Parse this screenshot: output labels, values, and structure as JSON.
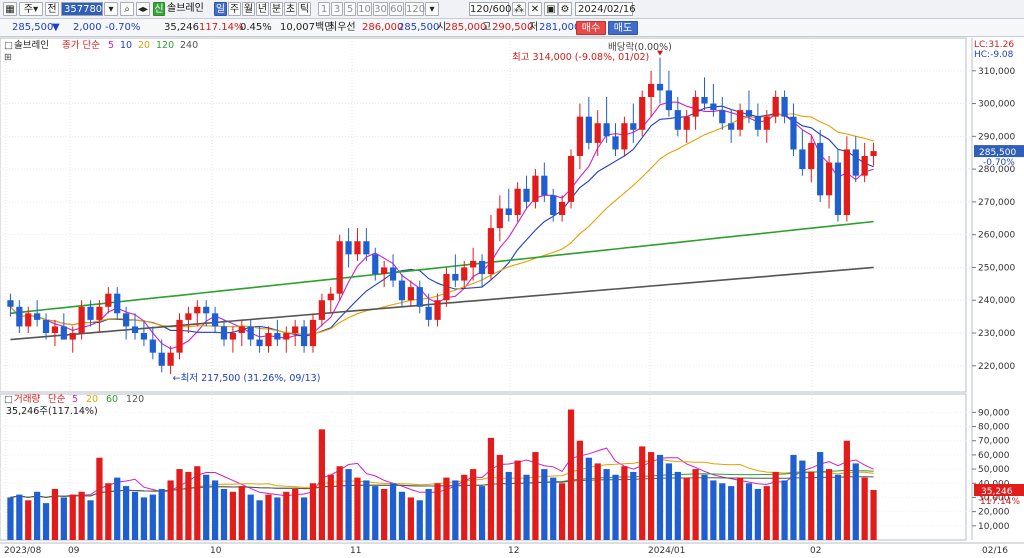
{
  "toolbar": {
    "code": "357780",
    "stock_name": "솔브레인",
    "period_buttons": [
      "일",
      "주",
      "월",
      "년",
      "분",
      "초",
      "틱"
    ],
    "minute_buttons": [
      "1",
      "3",
      "5",
      "10",
      "30",
      "60",
      "120"
    ],
    "count": "120/600",
    "date": "2024/02/16",
    "buy_label": "매수",
    "sell_label": "매도",
    "cal_label": "전",
    "small_icons": [
      "window-icon",
      "dropdown-icon",
      "refresh-icon",
      "chart-type-icon",
      "lock-icon",
      "gear-icon"
    ]
  },
  "quote": {
    "price": "285,500",
    "direction": "▼",
    "change": "2,000",
    "change_pct": "-0.70%",
    "volume": "35,246",
    "volume_ratio": "117.14%",
    "turnover_pct": "0.45%",
    "amount": "10,007백만",
    "bid_label": "최우선",
    "bid": "286,000",
    "ask": "285,500",
    "open_label": "시",
    "open": "285,000",
    "high_label": "고",
    "high": "290,500",
    "low_label": "저",
    "low": "281,000"
  },
  "price_panel": {
    "legend_name": "솔브레인",
    "legend_ma": "종가 단순",
    "ma_periods": [
      {
        "label": "5",
        "color": "#d020c8"
      },
      {
        "label": "10",
        "color": "#1f3fc7"
      },
      {
        "label": "20",
        "color": "#e8a000"
      },
      {
        "label": "120",
        "color": "#2ea02e"
      },
      {
        "label": "240",
        "color": "#555555"
      }
    ],
    "max_note": "최고 314,000 (-9.08%, 01/02)",
    "dividend_note": "배당락(0.00%)",
    "min_note": "←최저 217,500 (31.26%, 09/13)",
    "lc": "LC:31.26",
    "hc": "HC:-9.08",
    "price_box": "285,500",
    "price_box_pct": "-0.70%",
    "y_ticks": [
      "310,000",
      "300,000",
      "290,000",
      "280,000",
      "270,000",
      "260,000",
      "250,000",
      "240,000",
      "230,000",
      "220,000"
    ]
  },
  "volume_panel": {
    "legend_name": "거래량",
    "legend_ma": "단순",
    "ma_periods": [
      {
        "label": "5",
        "color": "#d020c8"
      },
      {
        "label": "20",
        "color": "#e8a000"
      },
      {
        "label": "60",
        "color": "#2ea02e"
      },
      {
        "label": "120",
        "color": "#555555"
      }
    ],
    "value_note": "35,246주(117.14%)",
    "vol_box": "35,246",
    "vol_box_pct": "117.14%",
    "y_ticks": [
      "90,000",
      "80,000",
      "70,000",
      "60,000",
      "50,000",
      "40,000",
      "30,000",
      "20,000",
      "10,000"
    ]
  },
  "x_labels": [
    "2023/08",
    "09",
    "10",
    "11",
    "12",
    "2024/01",
    "02",
    "02/16"
  ],
  "colors": {
    "up": "#e21b1b",
    "down": "#1f5fd0",
    "accent": "#3f6dc8"
  },
  "chart_data": {
    "type": "candlestick",
    "title": "솔브레인",
    "x_axis": [
      "2023/08",
      "09",
      "10",
      "11",
      "12",
      "2024/01",
      "02"
    ],
    "y_range": [
      212000,
      320000
    ],
    "volume_range": [
      0,
      98000
    ],
    "candles": [
      [
        240000,
        242000,
        235000,
        238000,
        30000
      ],
      [
        238000,
        240000,
        230000,
        232000,
        32000
      ],
      [
        232000,
        238000,
        230000,
        236000,
        28000
      ],
      [
        236000,
        240000,
        232000,
        234000,
        34000
      ],
      [
        234000,
        236000,
        228000,
        230000,
        26000
      ],
      [
        230000,
        234000,
        226000,
        232000,
        36000
      ],
      [
        232000,
        236000,
        228000,
        228000,
        30000
      ],
      [
        228000,
        232000,
        224000,
        230000,
        32000
      ],
      [
        230000,
        240000,
        228000,
        238000,
        34000
      ],
      [
        238000,
        240000,
        232000,
        234000,
        28000
      ],
      [
        234000,
        240000,
        230000,
        238000,
        58000
      ],
      [
        238000,
        244000,
        236000,
        242000,
        40000
      ],
      [
        242000,
        244000,
        234000,
        236000,
        44000
      ],
      [
        236000,
        238000,
        228000,
        232000,
        38000
      ],
      [
        232000,
        236000,
        228000,
        230000,
        34000
      ],
      [
        230000,
        234000,
        226000,
        228000,
        30000
      ],
      [
        228000,
        232000,
        222000,
        224000,
        32000
      ],
      [
        224000,
        228000,
        218000,
        220000,
        36000
      ],
      [
        220000,
        226000,
        217500,
        224000,
        42000
      ],
      [
        224000,
        236000,
        222000,
        234000,
        50000
      ],
      [
        234000,
        238000,
        230000,
        236000,
        48000
      ],
      [
        236000,
        240000,
        232000,
        238000,
        52000
      ],
      [
        238000,
        240000,
        232000,
        236000,
        46000
      ],
      [
        236000,
        238000,
        230000,
        232000,
        42000
      ],
      [
        232000,
        234000,
        226000,
        228000,
        36000
      ],
      [
        228000,
        232000,
        224000,
        230000,
        34000
      ],
      [
        230000,
        234000,
        226000,
        232000,
        38000
      ],
      [
        232000,
        234000,
        226000,
        228000,
        32000
      ],
      [
        228000,
        232000,
        224000,
        226000,
        28000
      ],
      [
        226000,
        232000,
        224000,
        230000,
        32000
      ],
      [
        230000,
        234000,
        226000,
        228000,
        30000
      ],
      [
        228000,
        232000,
        224000,
        230000,
        34000
      ],
      [
        230000,
        234000,
        226000,
        232000,
        36000
      ],
      [
        232000,
        234000,
        224000,
        226000,
        30000
      ],
      [
        226000,
        236000,
        224000,
        234000,
        40000
      ],
      [
        234000,
        242000,
        232000,
        240000,
        78000
      ],
      [
        240000,
        244000,
        236000,
        242000,
        46000
      ],
      [
        242000,
        260000,
        240000,
        258000,
        52000
      ],
      [
        258000,
        262000,
        250000,
        254000,
        50000
      ],
      [
        254000,
        262000,
        252000,
        258000,
        44000
      ],
      [
        258000,
        262000,
        252000,
        254000,
        42000
      ],
      [
        254000,
        256000,
        246000,
        248000,
        38000
      ],
      [
        248000,
        252000,
        244000,
        250000,
        36000
      ],
      [
        250000,
        254000,
        244000,
        246000,
        40000
      ],
      [
        246000,
        248000,
        238000,
        240000,
        34000
      ],
      [
        240000,
        246000,
        238000,
        244000,
        30000
      ],
      [
        244000,
        246000,
        236000,
        238000,
        28000
      ],
      [
        238000,
        242000,
        232000,
        234000,
        36000
      ],
      [
        234000,
        242000,
        232000,
        240000,
        40000
      ],
      [
        240000,
        250000,
        238000,
        248000,
        44000
      ],
      [
        248000,
        254000,
        244000,
        246000,
        42000
      ],
      [
        246000,
        252000,
        244000,
        250000,
        46000
      ],
      [
        250000,
        256000,
        246000,
        252000,
        50000
      ],
      [
        252000,
        254000,
        244000,
        248000,
        38000
      ],
      [
        248000,
        266000,
        246000,
        262000,
        72000
      ],
      [
        262000,
        272000,
        258000,
        268000,
        60000
      ],
      [
        268000,
        274000,
        264000,
        266000,
        48000
      ],
      [
        266000,
        276000,
        264000,
        274000,
        56000
      ],
      [
        274000,
        278000,
        268000,
        270000,
        46000
      ],
      [
        270000,
        280000,
        268000,
        278000,
        62000
      ],
      [
        278000,
        282000,
        270000,
        272000,
        50000
      ],
      [
        272000,
        274000,
        264000,
        266000,
        44000
      ],
      [
        266000,
        272000,
        264000,
        270000,
        40000
      ],
      [
        270000,
        286000,
        268000,
        284000,
        92000
      ],
      [
        284000,
        300000,
        280000,
        296000,
        70000
      ],
      [
        296000,
        302000,
        286000,
        288000,
        58000
      ],
      [
        288000,
        298000,
        284000,
        294000,
        54000
      ],
      [
        294000,
        302000,
        288000,
        290000,
        50000
      ],
      [
        290000,
        294000,
        284000,
        286000,
        46000
      ],
      [
        286000,
        296000,
        284000,
        294000,
        52000
      ],
      [
        294000,
        300000,
        288000,
        292000,
        48000
      ],
      [
        292000,
        304000,
        290000,
        302000,
        66000
      ],
      [
        302000,
        310000,
        296000,
        306000,
        62000
      ],
      [
        306000,
        314000,
        300000,
        304000,
        60000
      ],
      [
        304000,
        310000,
        296000,
        298000,
        54000
      ],
      [
        298000,
        302000,
        290000,
        292000,
        48000
      ],
      [
        292000,
        298000,
        288000,
        296000,
        44000
      ],
      [
        296000,
        304000,
        292000,
        302000,
        50000
      ],
      [
        302000,
        308000,
        298000,
        300000,
        46000
      ],
      [
        300000,
        306000,
        296000,
        298000,
        42000
      ],
      [
        298000,
        302000,
        292000,
        294000,
        40000
      ],
      [
        294000,
        298000,
        288000,
        292000,
        38000
      ],
      [
        292000,
        300000,
        290000,
        298000,
        44000
      ],
      [
        298000,
        304000,
        294000,
        296000,
        40000
      ],
      [
        296000,
        300000,
        290000,
        292000,
        36000
      ],
      [
        292000,
        298000,
        288000,
        296000,
        38000
      ],
      [
        296000,
        304000,
        294000,
        302000,
        48000
      ],
      [
        302000,
        304000,
        294000,
        296000,
        42000
      ],
      [
        296000,
        300000,
        284000,
        286000,
        60000
      ],
      [
        286000,
        292000,
        278000,
        280000,
        56000
      ],
      [
        280000,
        290000,
        276000,
        288000,
        48000
      ],
      [
        288000,
        292000,
        270000,
        272000,
        62000
      ],
      [
        272000,
        284000,
        268000,
        282000,
        50000
      ],
      [
        282000,
        286000,
        264000,
        266000,
        46000
      ],
      [
        266000,
        290000,
        264000,
        286000,
        70000
      ],
      [
        286000,
        290000,
        276000,
        278000,
        54000
      ],
      [
        278000,
        288000,
        276000,
        284000,
        44000
      ],
      [
        284000,
        288000,
        281000,
        285500,
        35246
      ]
    ]
  }
}
